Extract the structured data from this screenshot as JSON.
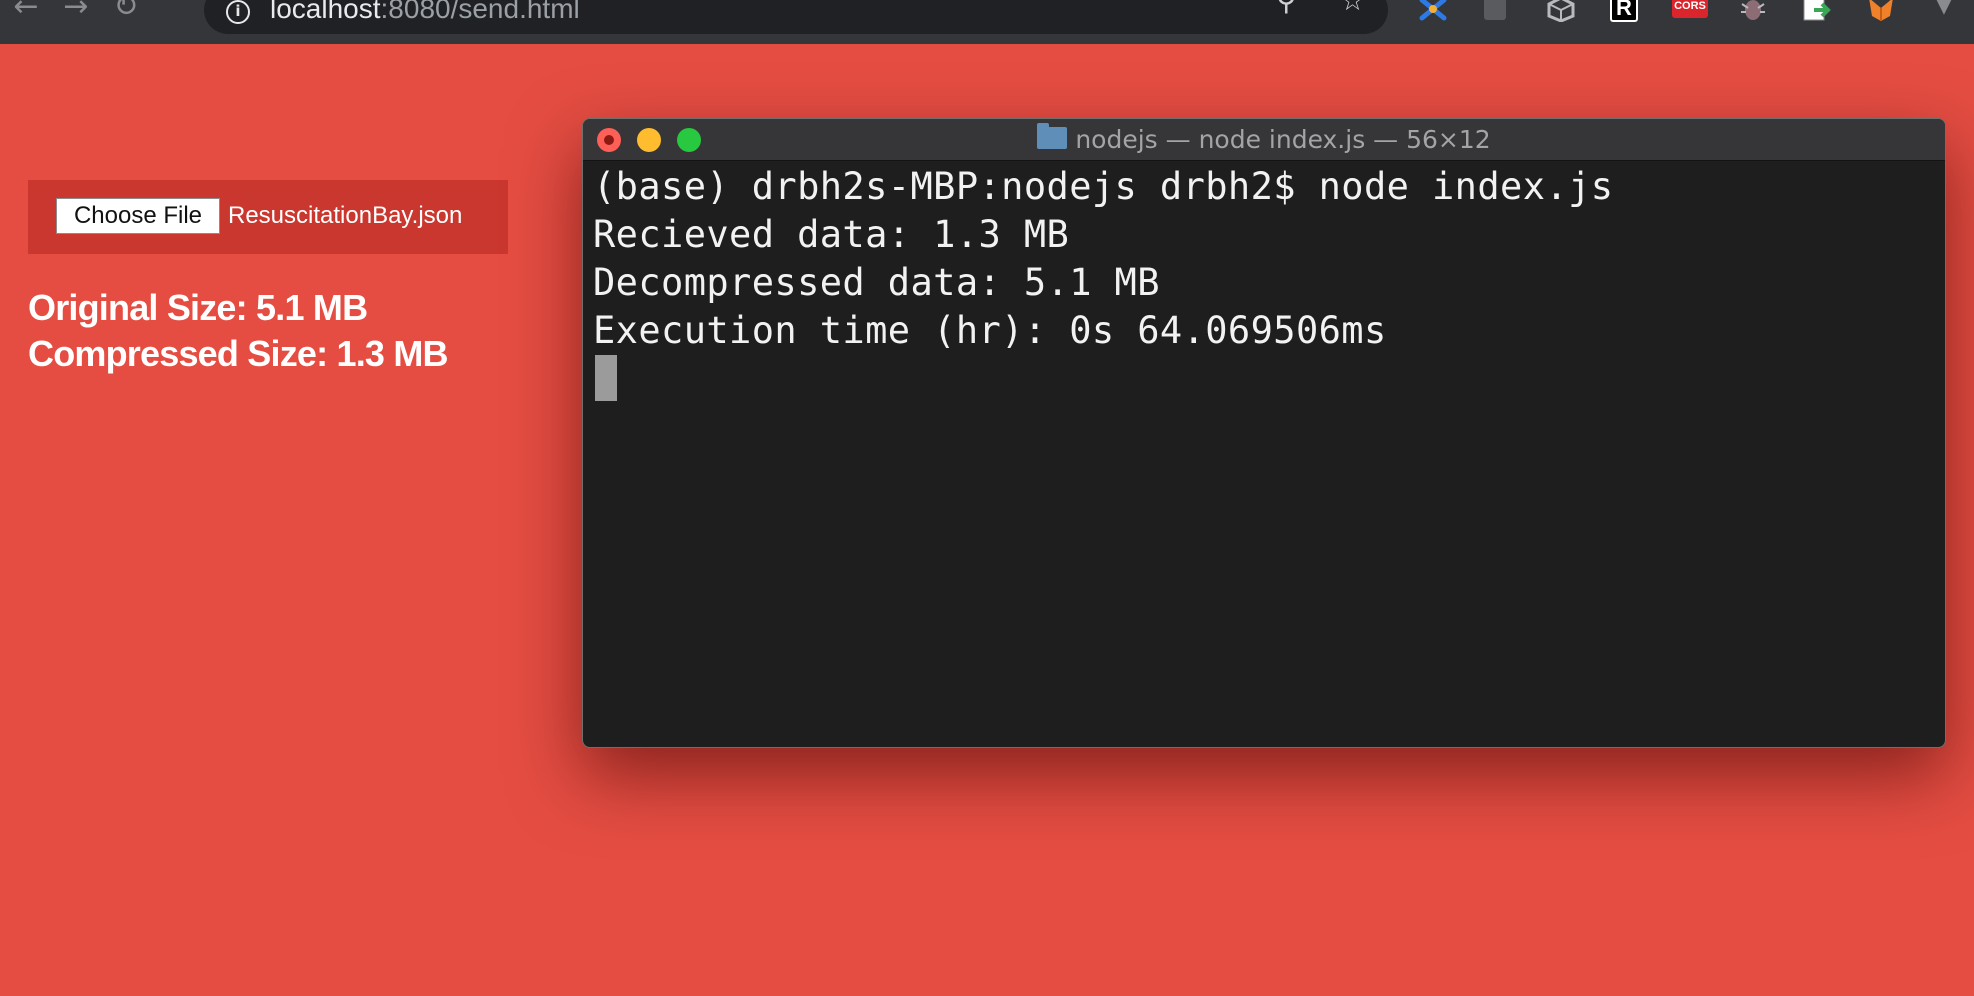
{
  "browser": {
    "back_glyph": "←",
    "forward_glyph": "→",
    "reload_glyph": "↻",
    "info_glyph": "i",
    "url_host": "localhost",
    "url_path": ":8080/send.html",
    "zoom_glyph": "⚲",
    "bookmark_glyph": "☆",
    "menu_glyph": "▼",
    "extensions": [
      {
        "icon": "pinwheel-extension-icon",
        "color": "#2d7ae6"
      },
      {
        "icon": "puzzle-extension-icon",
        "color": "#6a6b6e"
      },
      {
        "icon": "cube-extension-icon",
        "color": "#b9babc"
      },
      {
        "icon": "r-extension-icon",
        "color": "#000000",
        "label": "R"
      },
      {
        "icon": "cors-extension-icon",
        "color": "#d9252b",
        "label": "CORS"
      },
      {
        "icon": "bug-extension-icon",
        "color": "#9a7b83"
      },
      {
        "icon": "export-extension-icon",
        "color": "#3aa757"
      },
      {
        "icon": "fox-extension-icon",
        "color": "#f0812b"
      }
    ]
  },
  "page": {
    "background": "#e54d42",
    "choose_file_label": "Choose File",
    "file_name": "ResuscitationBay.json",
    "original_size": "Original Size: 5.1 MB",
    "compressed_size": "Compressed Size: 1.3 MB"
  },
  "terminal": {
    "title": "nodejs — node index.js — 56×12",
    "lines": [
      "(base) drbh2s-MBP:nodejs drbh2$ node index.js",
      "Recieved data: 1.3 MB",
      "Decompressed data: 5.1 MB",
      "Execution time (hr): 0s 64.069506ms"
    ]
  }
}
